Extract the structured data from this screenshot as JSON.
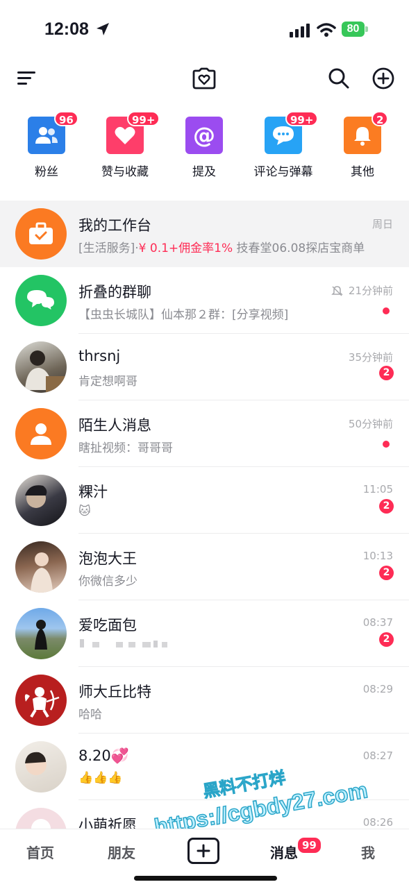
{
  "status_bar": {
    "time": "12:08",
    "battery": "80"
  },
  "top_nav": {
    "icons": [
      "menu-icon",
      "heart-camera-icon",
      "search-icon",
      "add-circle-icon"
    ]
  },
  "shortcuts": [
    {
      "label": "粉丝",
      "badge": "96",
      "icon": "fans-icon",
      "color": "#2b7fe8"
    },
    {
      "label": "赞与收藏",
      "badge": "99+",
      "icon": "heart-icon",
      "color": "#fe3e6a"
    },
    {
      "label": "提及",
      "badge": "",
      "icon": "at-icon",
      "color": "#9b4cf0"
    },
    {
      "label": "评论与弹幕",
      "badge": "99+",
      "icon": "comment-icon",
      "color": "#27a3f5"
    },
    {
      "label": "其他",
      "badge": "2",
      "icon": "bell-icon",
      "color": "#fb7c22"
    }
  ],
  "chats": [
    {
      "name": "我的工作台",
      "preview_pre": "[生活服务]·",
      "preview_red": "¥ 0.1+佣金率1%",
      "preview_post": " 技春堂06.08探店宝商单",
      "time": "周日",
      "unread": "",
      "dot": false,
      "pinned": true
    },
    {
      "name": "折叠的群聊",
      "preview": "【虫虫长城队】仙本那２群：[分享视频]",
      "time": "21分钟前",
      "muted": true,
      "unread": "",
      "dot": true
    },
    {
      "name": "thrsnj",
      "preview": "肯定想啊哥",
      "time": "35分钟前",
      "unread": "2",
      "dot": false
    },
    {
      "name": "陌生人消息",
      "preview": "瞎扯视频：哥哥哥",
      "time": "50分钟前",
      "unread": "",
      "dot": true
    },
    {
      "name": "粿汁",
      "preview": "🐱",
      "time": "11:05",
      "unread": "2",
      "dot": false
    },
    {
      "name": "泡泡大王",
      "preview": "你微信多少",
      "time": "10:13",
      "unread": "2",
      "dot": false
    },
    {
      "name": "爱吃面包",
      "preview": "",
      "time": "08:37",
      "unread": "2",
      "dot": false,
      "blurred": true
    },
    {
      "name": "师大丘比特",
      "preview": "哈哈",
      "time": "08:29",
      "unread": "",
      "dot": false
    },
    {
      "name": "8.20💞",
      "preview": "👍👍👍",
      "time": "08:27",
      "unread": "",
      "dot": false
    },
    {
      "name": "小萌祈愿",
      "preview": "",
      "time": "08:26",
      "unread": "",
      "dot": false
    }
  ],
  "tabs": [
    {
      "label": "首页"
    },
    {
      "label": "朋友"
    },
    {
      "label": "消息",
      "badge": "99"
    },
    {
      "label": "我"
    }
  ],
  "watermark": {
    "line1": "黑料不打烊",
    "line2": "https://cgbdy27.com"
  },
  "colors": {
    "accent": "#fe2c55",
    "pinned_bg": "#f3f3f4"
  }
}
